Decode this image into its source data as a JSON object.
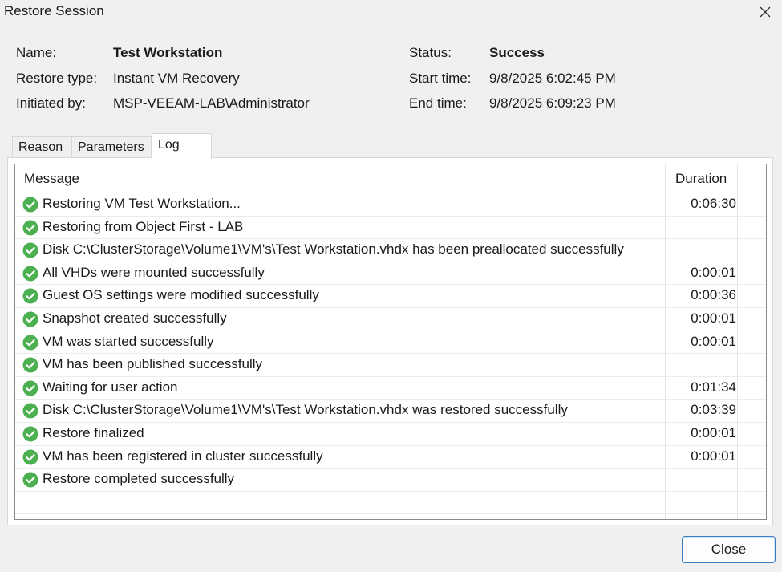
{
  "window": {
    "title": "Restore Session",
    "close_glyph": "✕"
  },
  "summary": {
    "name_label": "Name:",
    "name_value": "Test Workstation",
    "restore_type_label": "Restore type:",
    "restore_type_value": "Instant VM Recovery",
    "initiated_label": "Initiated by:",
    "initiated_value": "MSP-VEEAM-LAB\\Administrator",
    "status_label": "Status:",
    "status_value": "Success",
    "start_label": "Start time:",
    "start_value": "9/8/2025 6:02:45 PM",
    "end_label": "End time:",
    "end_value": "9/8/2025 6:09:23 PM"
  },
  "tabs": [
    {
      "label": "Reason",
      "active": false
    },
    {
      "label": "Parameters",
      "active": false
    },
    {
      "label": "Log",
      "active": true
    }
  ],
  "log": {
    "columns": {
      "message": "Message",
      "duration": "Duration"
    },
    "status_icon": "check-circle-icon",
    "success_color": "#4caf50",
    "rows": [
      {
        "message": "Restoring VM Test Workstation...",
        "duration": "0:06:30"
      },
      {
        "message": "Restoring from Object First - LAB",
        "duration": ""
      },
      {
        "message": "Disk C:\\ClusterStorage\\Volume1\\VM's\\Test Workstation.vhdx has been preallocated successfully",
        "duration": ""
      },
      {
        "message": "All VHDs were mounted successfully",
        "duration": "0:00:01"
      },
      {
        "message": "Guest OS settings were modified successfully",
        "duration": "0:00:36"
      },
      {
        "message": "Snapshot created successfully",
        "duration": "0:00:01"
      },
      {
        "message": "VM was started successfully",
        "duration": "0:00:01"
      },
      {
        "message": "VM has been published successfully",
        "duration": ""
      },
      {
        "message": "Waiting for user action",
        "duration": "0:01:34"
      },
      {
        "message": "Disk C:\\ClusterStorage\\Volume1\\VM's\\Test Workstation.vhdx was restored successfully",
        "duration": "0:03:39"
      },
      {
        "message": "Restore finalized",
        "duration": "0:00:01"
      },
      {
        "message": "VM has been registered in cluster successfully",
        "duration": "0:00:01"
      },
      {
        "message": "Restore completed successfully",
        "duration": ""
      }
    ]
  },
  "buttons": {
    "close_label": "Close"
  }
}
